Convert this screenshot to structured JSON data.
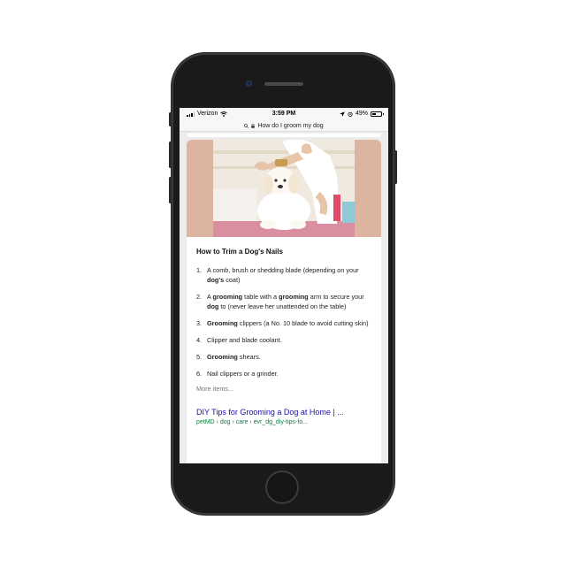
{
  "status_bar": {
    "carrier": "Verizon",
    "time": "3:59 PM",
    "battery": "49%",
    "battery_level": 0.49
  },
  "address_bar": {
    "query": "How do I groom my dog"
  },
  "featured_snippet": {
    "heading": "How to Trim a Dog's Nails",
    "items": [
      {
        "num": "1.",
        "parts": [
          [
            "A comb, brush or shedding blade (depending on your ",
            false
          ],
          [
            "dog's",
            true
          ],
          [
            " coat)",
            false
          ]
        ]
      },
      {
        "num": "2.",
        "parts": [
          [
            "A ",
            false
          ],
          [
            "grooming",
            true
          ],
          [
            " table with a ",
            false
          ],
          [
            "grooming",
            true
          ],
          [
            " arm to secure your ",
            false
          ],
          [
            "dog",
            true
          ],
          [
            " to (never leave her unattended on the table)",
            false
          ]
        ]
      },
      {
        "num": "3.",
        "parts": [
          [
            "Grooming",
            true
          ],
          [
            " clippers (a No. 10 blade to avoid cutting skin)",
            false
          ]
        ]
      },
      {
        "num": "4.",
        "parts": [
          [
            "Clipper and blade coolant.",
            false
          ]
        ]
      },
      {
        "num": "5.",
        "parts": [
          [
            "Grooming",
            true
          ],
          [
            " shears.",
            false
          ]
        ]
      },
      {
        "num": "6.",
        "parts": [
          [
            "Nail clippers or a grinder.",
            false
          ]
        ]
      }
    ],
    "more_label": "More items..."
  },
  "result": {
    "title": "DIY Tips for Grooming a Dog at Home | ...",
    "breadcrumb": "petMD › dog › care › evr_dg_diy-tips-fo..."
  },
  "colors": {
    "link": "#1a0dab",
    "url": "#0b8043",
    "hero_bg": "#dcb4a0"
  }
}
